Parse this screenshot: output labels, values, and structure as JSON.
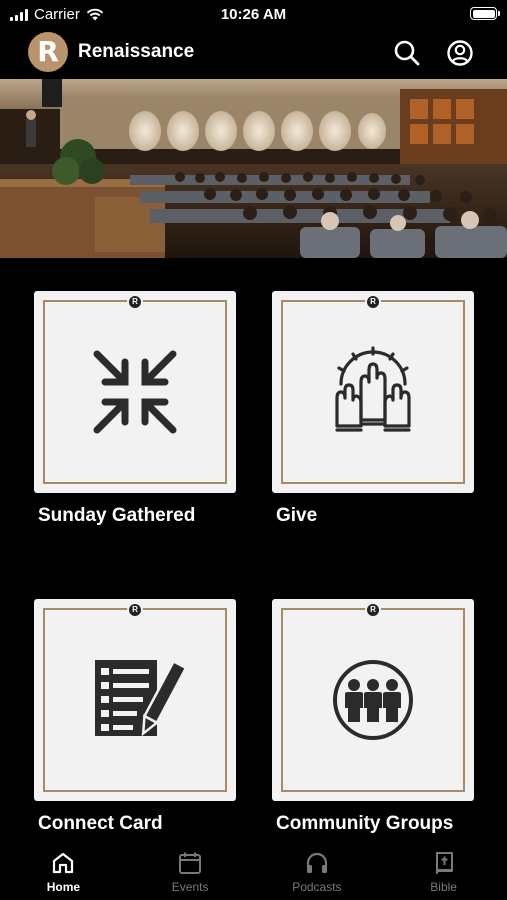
{
  "status_bar": {
    "carrier": "Carrier",
    "time": "10:26 AM"
  },
  "header": {
    "title": "Renaissance",
    "logo_letter": "R",
    "brand_color": "#b8936b",
    "search_icon": "search-icon",
    "profile_icon": "profile-icon"
  },
  "tiles": [
    {
      "label": "Sunday Gathered",
      "icon": "arrows-inward-icon",
      "badge": "R"
    },
    {
      "label": "Give",
      "icon": "raised-hands-icon",
      "badge": "R"
    },
    {
      "label": "Connect Card",
      "icon": "checklist-pencil-icon",
      "badge": "R"
    },
    {
      "label": "Community Groups",
      "icon": "people-group-icon",
      "badge": "R"
    }
  ],
  "tab_bar": {
    "tabs": [
      {
        "label": "Home",
        "icon": "home-icon",
        "active": true
      },
      {
        "label": "Events",
        "icon": "calendar-icon",
        "active": false
      },
      {
        "label": "Podcasts",
        "icon": "headphones-icon",
        "active": false
      },
      {
        "label": "Bible",
        "icon": "bible-icon",
        "active": false
      }
    ]
  },
  "colors": {
    "background": "#000000",
    "tile": "#f2f2f2",
    "frame": "#a98a66",
    "inactive_tab": "#7a7a7a"
  }
}
